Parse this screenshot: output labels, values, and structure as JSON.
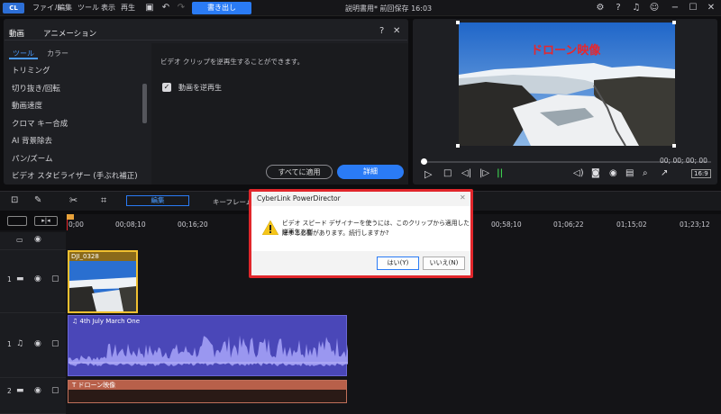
{
  "app": {
    "logo": "CL",
    "menu": [
      "ファイル",
      "編集",
      "ツール",
      "表示",
      "再生"
    ],
    "export_label": "書き出し",
    "project_status": "説明書用* 前回保存 16:03"
  },
  "left_panel": {
    "tabs": [
      "動画",
      "アニメーション"
    ],
    "subtabs": [
      "ツール",
      "カラー"
    ],
    "help": "?",
    "close": "✕",
    "tools": [
      "トリミング",
      "切り抜き/回転",
      "動画速度",
      "クロマ キー合成",
      "AI 背景除去",
      "パン/ズーム",
      "ビデオ スタビライザー (手ぶれ補正)"
    ],
    "description": "ビデオ クリップを逆再生することができます。",
    "reverse_label": "動画を逆再生",
    "apply_all_label": "すべてに適用",
    "detail_label": "詳細"
  },
  "preview": {
    "title_overlay": "ドローン映像",
    "timecode": "00; 00; 00; 00",
    "aspect": "16:9"
  },
  "timeline": {
    "toolbar_edit": "編集",
    "toolbar_keyframe": "キーフレーム",
    "ruler": [
      "0;00",
      "00;08;10",
      "00;16;20",
      "00;58;10",
      "01;06;22",
      "01;15;02",
      "01;23;12"
    ],
    "video_clip_name": "DJI_0328",
    "audio_clip_name": "4th July March One",
    "title_clip_name": "ドローン映像",
    "track_numbers": [
      "1",
      "1",
      "2"
    ]
  },
  "dialog": {
    "title": "CyberLink PowerDirector",
    "message_line1": "ビデオ スピード デザイナーを使うには、このクリップから適用した逆再生を削",
    "message_line2": "除する必要があります。続行しますか?",
    "yes_label": "はい(Y)",
    "no_label": "いいえ(N)"
  }
}
